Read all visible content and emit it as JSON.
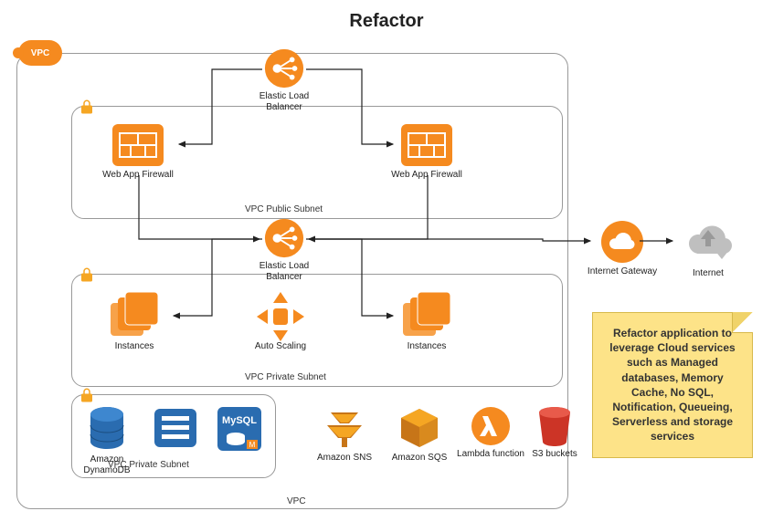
{
  "title": "Refactor",
  "vpc_badge": "VPC",
  "subnets": {
    "public_label": "VPC Public Subnet",
    "private_label": "VPC Private Subnet",
    "db_label": "VPC Private Subnet",
    "vpc_footer": "VPC"
  },
  "nodes": {
    "elb_top": "Elastic Load Balancer",
    "waf_left": "Web App Firewall",
    "waf_right": "Web App Firewall",
    "elb_mid": "Elastic Load Balancer",
    "instances_left": "Instances",
    "autoscaling": "Auto Scaling",
    "instances_right": "Instances",
    "dynamodb": "Amazon DynamoDB",
    "mysql_caption": "",
    "sns": "Amazon SNS",
    "sqs": "Amazon SQS",
    "lambda": "Lambda function",
    "s3": "S3 buckets",
    "igw": "Internet Gateway",
    "internet": "Internet"
  },
  "note_text": "Refactor application to leverage Cloud services such as Managed databases, Memory Cache, No SQL, Notification, Queueing, Serverless and storage services",
  "colors": {
    "aws_orange": "#f58a1f",
    "dark_orange": "#d96f12",
    "mysql_blue": "#2a6cb0",
    "red": "#cc3426",
    "gray": "#bfbfbf",
    "note_bg": "#fde388"
  }
}
